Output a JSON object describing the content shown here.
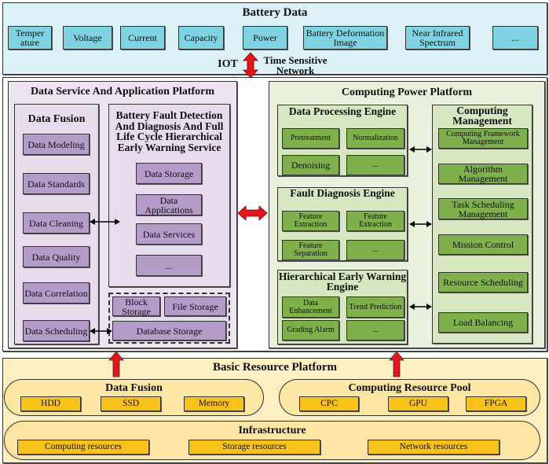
{
  "battery_data": {
    "title": "Battery Data",
    "items": [
      "Temper ature",
      "Voltage",
      "Current",
      "Capacity",
      "Power",
      "Battery Deformation Image",
      "Near Infrared Spectrum",
      "..."
    ]
  },
  "link": {
    "left_label": "IOT",
    "right_label": "Time Sensitive Network"
  },
  "data_service": {
    "title": "Data Service And Application Platform",
    "fusion": {
      "title": "Data Fusion",
      "items": [
        "Data Modeling",
        "Data Standards",
        "Data Cleaning",
        "Data Quality",
        "Data Correlation",
        "Data Scheduling"
      ]
    },
    "service": {
      "title": "Battery Fault Detection And Diagnosis And Full Life Cycle Hierarchical Early Warning Service",
      "items": [
        "Data Storage",
        "Data Applications",
        "Data Services",
        "..."
      ]
    },
    "storage": {
      "items": [
        "Block Storage",
        "File Storage",
        "Database Storage"
      ]
    }
  },
  "computing": {
    "title": "Computing Power Platform",
    "processing": {
      "title": "Data Processing Engine",
      "items": [
        "Pretreatment",
        "Normalization",
        "Denoising",
        "..."
      ]
    },
    "fault": {
      "title": "Fault Diagnosis Engine",
      "items": [
        "Feature Extraction",
        "Feature Extraction",
        "Feature Separation",
        "..."
      ]
    },
    "warning": {
      "title": "Hierarchical Early Warning Engine",
      "items": [
        "Data Enhancement",
        "Trend Prediction",
        "Grading Alarm",
        "..."
      ]
    },
    "management": {
      "title": "Computing Management",
      "items": [
        "Computing Framework Management",
        "Algorithm Management",
        "Task Scheduling Management",
        "Mission Control",
        "Resource Scheduling",
        "Load Balancing"
      ]
    }
  },
  "basic": {
    "title": "Basic Resource Platform",
    "fusion": {
      "title": "Data Fusion",
      "items": [
        "HDD",
        "SSD",
        "Memory"
      ]
    },
    "pool": {
      "title": "Computing Resource Pool",
      "items": [
        "CPC",
        "GPU",
        "FPGA"
      ]
    },
    "infra": {
      "title": "Infrastructure",
      "items": [
        "Computing resources",
        "Storage resources",
        "Network resources"
      ]
    }
  },
  "colors": {
    "battery_bg": "#dcf0f6",
    "battery_item": "#7fd3e0",
    "service_bg": "#ece5f0",
    "service_item": "#b49cc8",
    "compute_bg": "#e9f1de",
    "compute_item": "#7fb04c",
    "basic_bg": "#fcefc2",
    "basic_item": "#f8c21a",
    "red_arrow": "#e8141b"
  }
}
